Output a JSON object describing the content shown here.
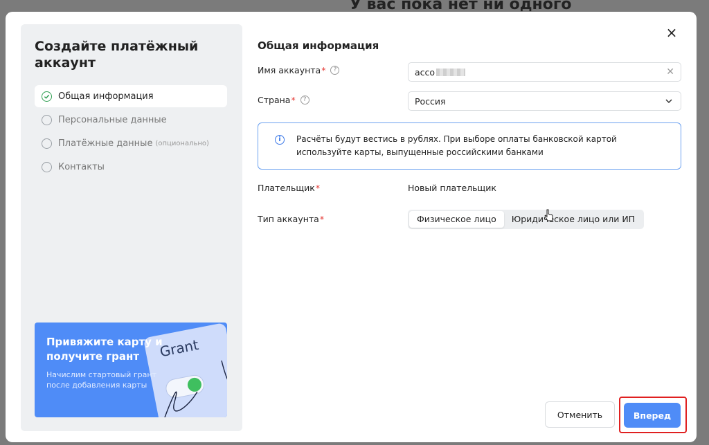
{
  "background": {
    "title": "У вас пока нет ни одного"
  },
  "modal": {
    "close_label": "×",
    "sidebar": {
      "title": "Создайте платёжный аккаунт",
      "steps": [
        {
          "label": "Общая информация",
          "note": "",
          "state": "done"
        },
        {
          "label": "Персональные данные",
          "note": "",
          "state": "pending"
        },
        {
          "label": "Платёжные данные",
          "note": "(опционально)",
          "state": "pending"
        },
        {
          "label": "Контакты",
          "note": "",
          "state": "pending"
        }
      ],
      "promo": {
        "title": "Привяжите карту и получите грант",
        "text": "Начислим стартовый грант после добавления карты",
        "card_word": "Grant"
      }
    },
    "form": {
      "title": "Общая информация",
      "account_name": {
        "label": "Имя аккаунта",
        "required_mark": "*",
        "value": "acco"
      },
      "country": {
        "label": "Страна",
        "required_mark": "*",
        "value": "Россия"
      },
      "info": "Расчёты будут вестись в рублях. При выборе оплаты банковской картой используйте карты, выпущенные российскими банками",
      "payer": {
        "label": "Плательщик",
        "required_mark": "*",
        "value": "Новый плательщик"
      },
      "account_type": {
        "label": "Тип аккаунта",
        "required_mark": "*",
        "options": [
          "Физическое лицо",
          "Юридическое лицо или ИП"
        ],
        "selected": "Физическое лицо"
      }
    },
    "buttons": {
      "cancel": "Отменить",
      "next": "Вперед"
    }
  },
  "colors": {
    "accent": "#4f8cf7",
    "required": "#e53935",
    "highlight": "#e02020",
    "done": "#2f9e52"
  }
}
